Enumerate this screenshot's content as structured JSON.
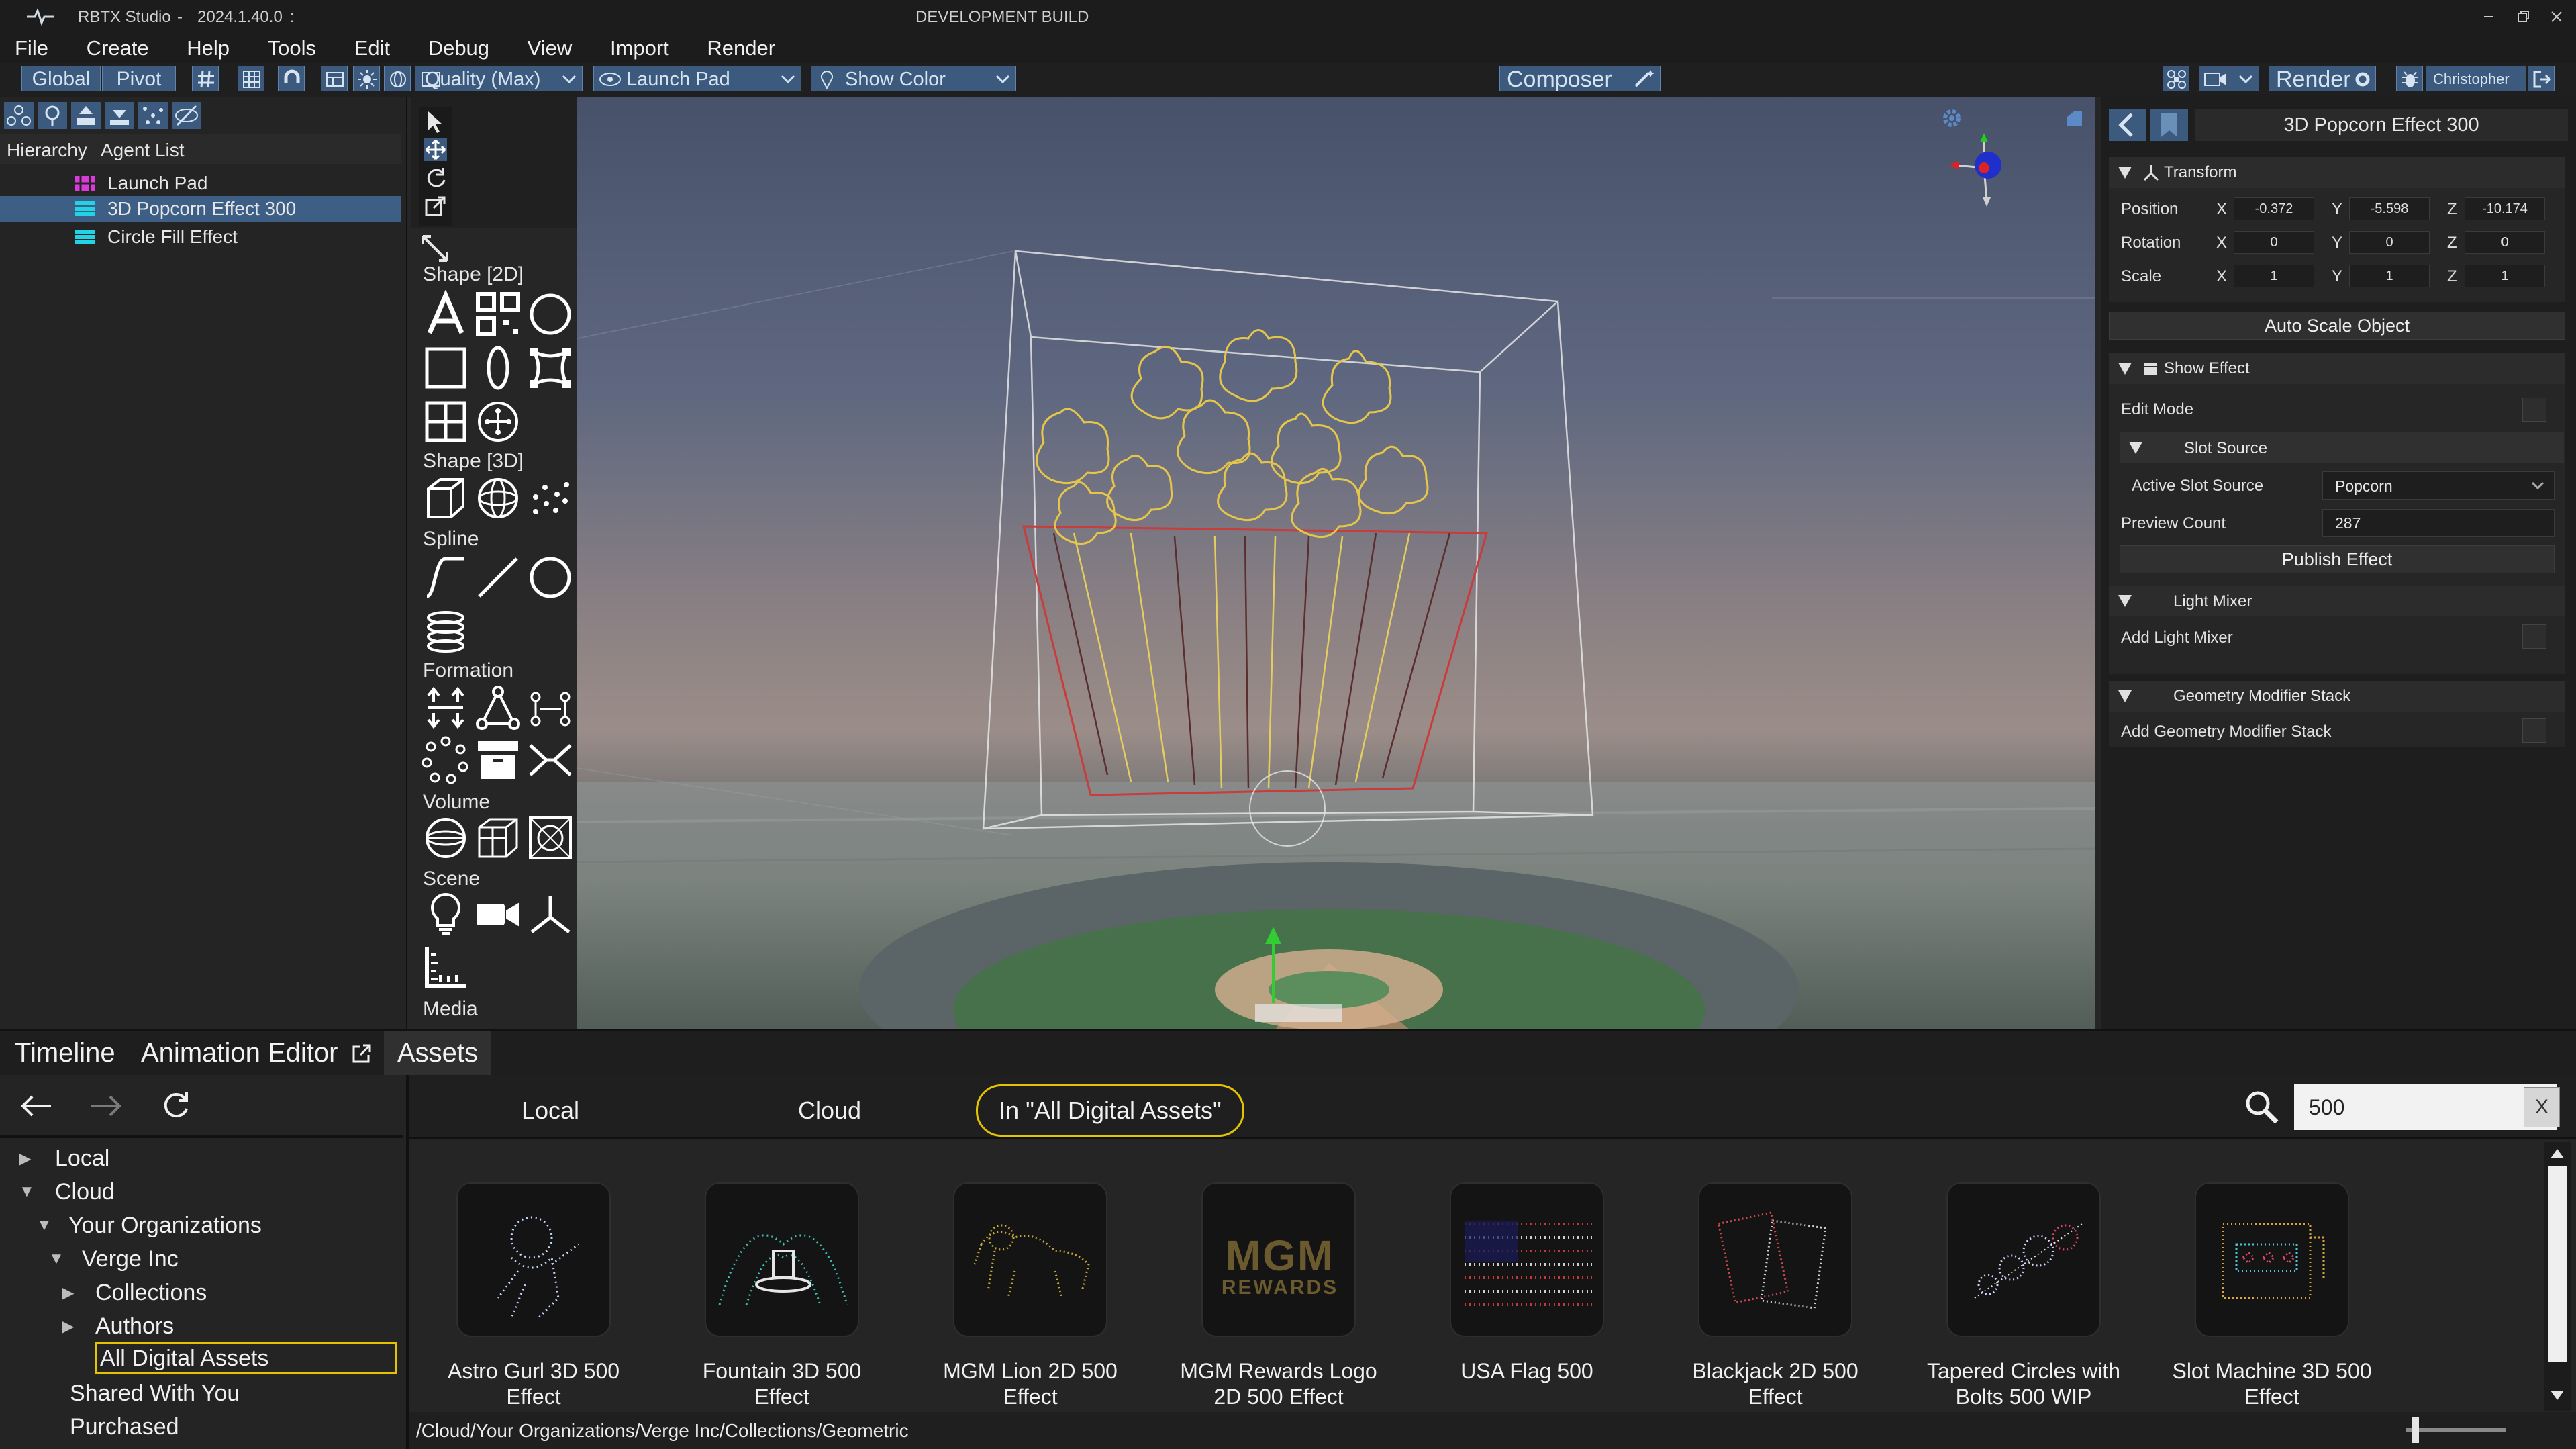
{
  "titlebar": {
    "app_name": "RBTX Studio",
    "separator": "-",
    "version": "2024.1.40.0",
    "colon": ":",
    "build_label": "DEVELOPMENT BUILD",
    "minimize_icon": "minimize-icon",
    "restore_icon": "restore-icon",
    "close_icon": "close-icon"
  },
  "menu": [
    "File",
    "Create",
    "Help",
    "Tools",
    "Edit",
    "Debug",
    "View",
    "Import",
    "Render"
  ],
  "toolbar": {
    "global_label": "Global",
    "pivot_label": "Pivot",
    "quality_label": "Quality (Max)",
    "launchpad_label": "Launch Pad",
    "showcolor_label": "Show Color",
    "composer_label": "Composer",
    "render_label": "Render",
    "user_label": "Christopher",
    "accent": "#3c5a7d"
  },
  "left_panel": {
    "tabs": [
      "Hierarchy",
      "Agent List"
    ],
    "items": [
      {
        "label": "Launch Pad",
        "icon": "launchpad-icon",
        "color": "#d93bd9",
        "selected": false
      },
      {
        "label": "3D Popcorn Effect 300",
        "icon": "effect-icon",
        "color": "#22d3e6",
        "selected": true
      },
      {
        "label": "Circle Fill Effect",
        "icon": "effect-icon",
        "color": "#22d3e6",
        "selected": false
      }
    ]
  },
  "palette": {
    "sections": [
      "Shape [2D]",
      "Shape [3D]",
      "Spline",
      "Formation",
      "Volume",
      "Scene",
      "Media"
    ]
  },
  "inspector": {
    "title": "3D Popcorn Effect 300",
    "transform": {
      "title": "Transform",
      "position_label": "Position",
      "rotation_label": "Rotation",
      "scale_label": "Scale",
      "x": "X",
      "y": "Y",
      "z": "Z",
      "position": [
        "-0.372",
        "-5.598",
        "-10.174"
      ],
      "rotation": [
        "0",
        "0",
        "0"
      ],
      "scale": [
        "1",
        "1",
        "1"
      ]
    },
    "auto_scale_label": "Auto Scale Object",
    "show_effect": {
      "title": "Show Effect",
      "edit_mode_label": "Edit Mode",
      "slot_source_title": "Slot Source",
      "active_slot_source_label": "Active Slot Source",
      "active_slot_source_value": "Popcorn",
      "preview_count_label": "Preview Count",
      "preview_count_value": "287",
      "publish_label": "Publish Effect"
    },
    "light_mixer": {
      "title": "Light Mixer",
      "add_label": "Add Light Mixer"
    },
    "geometry_stack": {
      "title": "Geometry Modifier Stack",
      "add_label": "Add Geometry Modifier Stack"
    }
  },
  "bottom_tabs": [
    "Timeline",
    "Animation Editor",
    "Assets"
  ],
  "nav": {
    "tree": [
      {
        "label": "Local",
        "arrow": "▶"
      },
      {
        "label": "Cloud",
        "arrow": "▼"
      },
      {
        "label": "Your Organizations",
        "arrow": "▼"
      },
      {
        "label": "Verge Inc",
        "arrow": "▼"
      },
      {
        "label": "Collections",
        "arrow": "▶"
      },
      {
        "label": "Authors",
        "arrow": "▶"
      },
      {
        "label": "All Digital Assets",
        "arrow": ""
      },
      {
        "label": "Shared With You",
        "arrow": ""
      },
      {
        "label": "Purchased",
        "arrow": ""
      }
    ]
  },
  "assets": {
    "filters": [
      "Local",
      "Cloud",
      "In \"All Digital Assets\""
    ],
    "search_value": "500",
    "clear_label": "X",
    "path": "/Cloud/Your Organizations/Verge Inc/Collections/Geometric",
    "items": [
      {
        "line1": "Astro Gurl 3D 500",
        "line2": "Effect"
      },
      {
        "line1": "Fountain 3D 500",
        "line2": "Effect"
      },
      {
        "line1": "MGM Lion 2D 500",
        "line2": "Effect"
      },
      {
        "line1": "MGM Rewards Logo",
        "line2": "2D 500 Effect"
      },
      {
        "line1": "USA Flag 500",
        "line2": ""
      },
      {
        "line1": "Blackjack 2D 500",
        "line2": "Effect"
      },
      {
        "line1": "Tapered Circles with",
        "line2": "Bolts 500 WIP"
      },
      {
        "line1": "Slot Machine 3D 500",
        "line2": "Effect"
      }
    ],
    "thumb_text": {
      "mgm_line1": "MGM",
      "mgm_line2": "REWARDS"
    }
  }
}
